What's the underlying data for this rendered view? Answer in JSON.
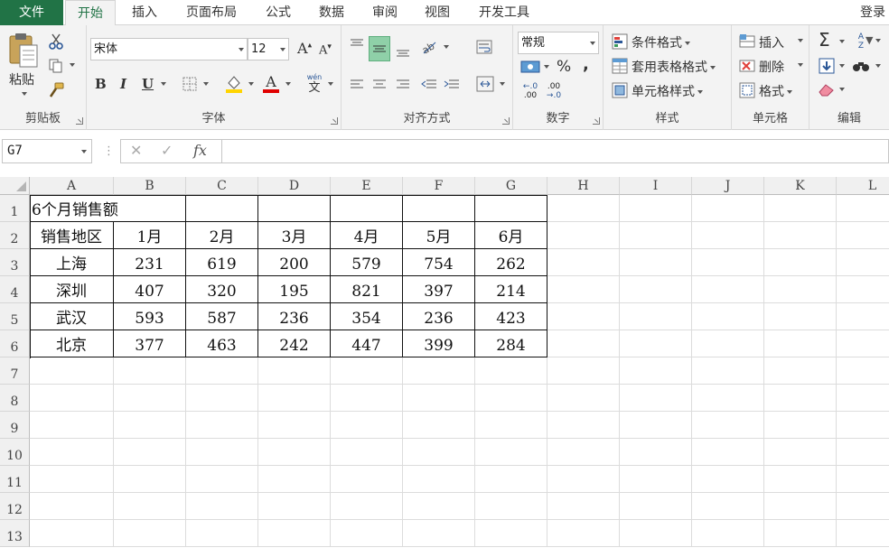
{
  "tabs": {
    "file": "文件",
    "items": [
      "开始",
      "插入",
      "页面布局",
      "公式",
      "数据",
      "审阅",
      "视图",
      "开发工具"
    ],
    "login": "登录"
  },
  "ribbon": {
    "clipboard": {
      "paste": "粘贴",
      "label": "剪贴板"
    },
    "font": {
      "name": "宋体",
      "size": "12",
      "label": "字体",
      "bold": "B",
      "italic": "I",
      "underline": "U",
      "grow": "A",
      "shrink": "A",
      "color_a": "A",
      "phonetic_top": "wén",
      "phonetic_bottom": "文"
    },
    "alignment": {
      "label": "对齐方式"
    },
    "number": {
      "format": "常规",
      "percent": "%",
      "comma": ",",
      "label": "数字",
      "dec_inc_top": "←.0",
      "dec_inc_bottom": ".00",
      "dec_dec_top": ".00",
      "dec_dec_bottom": "→.0"
    },
    "styles": {
      "conditional": "条件格式",
      "table": "套用表格格式",
      "cell": "单元格样式",
      "label": "样式"
    },
    "cells": {
      "insert": "插入",
      "delete": "删除",
      "format": "格式",
      "label": "单元格"
    },
    "editing": {
      "label": "编辑",
      "sort_top": "A",
      "sort_bottom": "Z"
    },
    "colors": {
      "accent": "#217346",
      "highlight": "#ffd400",
      "fontcolor": "#e00000"
    }
  },
  "formula_bar": {
    "name_box": "G7",
    "cancel": "✕",
    "enter": "✓",
    "fx": "fx",
    "value": ""
  },
  "sheet": {
    "columns": [
      "A",
      "B",
      "C",
      "D",
      "E",
      "F",
      "G",
      "H",
      "I",
      "J",
      "K",
      "L"
    ],
    "rows": [
      "1",
      "2",
      "3",
      "4",
      "5",
      "6",
      "7",
      "8",
      "9",
      "10",
      "11",
      "12",
      "13"
    ],
    "title": "6个月销售额",
    "header": [
      "销售地区",
      "1月",
      "2月",
      "3月",
      "4月",
      "5月",
      "6月"
    ],
    "data": [
      [
        "上海",
        "231",
        "619",
        "200",
        "579",
        "754",
        "262"
      ],
      [
        "深圳",
        "407",
        "320",
        "195",
        "821",
        "397",
        "214"
      ],
      [
        "武汉",
        "593",
        "587",
        "236",
        "354",
        "236",
        "423"
      ],
      [
        "北京",
        "377",
        "463",
        "242",
        "447",
        "399",
        "284"
      ]
    ]
  }
}
